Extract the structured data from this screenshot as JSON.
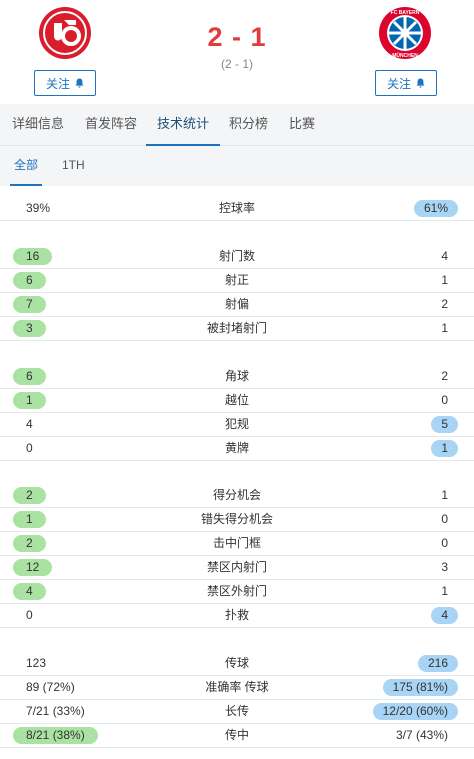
{
  "match": {
    "score": "2 - 1",
    "halftime": "(2 - 1)"
  },
  "home": {
    "follow_label": "关注",
    "color": "#d81e2c"
  },
  "away": {
    "follow_label": "关注",
    "logo_top": "FC BAYERN",
    "logo_bottom": "MÜNCHEN",
    "color": "#dc052d"
  },
  "tabs": [
    "详细信息",
    "首发阵容",
    "技术统计",
    "积分榜",
    "比赛"
  ],
  "active_tab": "技术统计",
  "subtabs": [
    "全部",
    "1TH"
  ],
  "active_subtab": "全部",
  "colors": {
    "accent": "#1e73be",
    "home_highlight": "#a9e2a2",
    "away_highlight": "#a8d4f5",
    "score": "#e23b3b"
  },
  "stats": [
    {
      "name": "控球率",
      "home": "39%",
      "away": "61%",
      "leader": "away"
    },
    {
      "name": "射门数",
      "home": "16",
      "away": "4",
      "leader": "home"
    },
    {
      "name": "射正",
      "home": "6",
      "away": "1",
      "leader": "home"
    },
    {
      "name": "射偏",
      "home": "7",
      "away": "2",
      "leader": "home"
    },
    {
      "name": "被封堵射门",
      "home": "3",
      "away": "1",
      "leader": "home"
    },
    {
      "name": "角球",
      "home": "6",
      "away": "2",
      "leader": "home"
    },
    {
      "name": "越位",
      "home": "1",
      "away": "0",
      "leader": "home"
    },
    {
      "name": "犯规",
      "home": "4",
      "away": "5",
      "leader": "away"
    },
    {
      "name": "黄牌",
      "home": "0",
      "away": "1",
      "leader": "away"
    },
    {
      "name": "得分机会",
      "home": "2",
      "away": "1",
      "leader": "home"
    },
    {
      "name": "错失得分机会",
      "home": "1",
      "away": "0",
      "leader": "home"
    },
    {
      "name": "击中门框",
      "home": "2",
      "away": "0",
      "leader": "home"
    },
    {
      "name": "禁区内射门",
      "home": "12",
      "away": "3",
      "leader": "home"
    },
    {
      "name": "禁区外射门",
      "home": "4",
      "away": "1",
      "leader": "home"
    },
    {
      "name": "扑救",
      "home": "0",
      "away": "4",
      "leader": "away"
    },
    {
      "name": "传球",
      "home": "123",
      "away": "216",
      "leader": "away"
    },
    {
      "name": "准确率 传球",
      "home": "89 (72%)",
      "away": "175 (81%)",
      "leader": "away"
    },
    {
      "name": "长传",
      "home": "7/21 (33%)",
      "away": "12/20 (60%)",
      "leader": "away"
    },
    {
      "name": "传中",
      "home": "8/21 (38%)",
      "away": "3/7 (43%)",
      "leader": "home"
    }
  ]
}
